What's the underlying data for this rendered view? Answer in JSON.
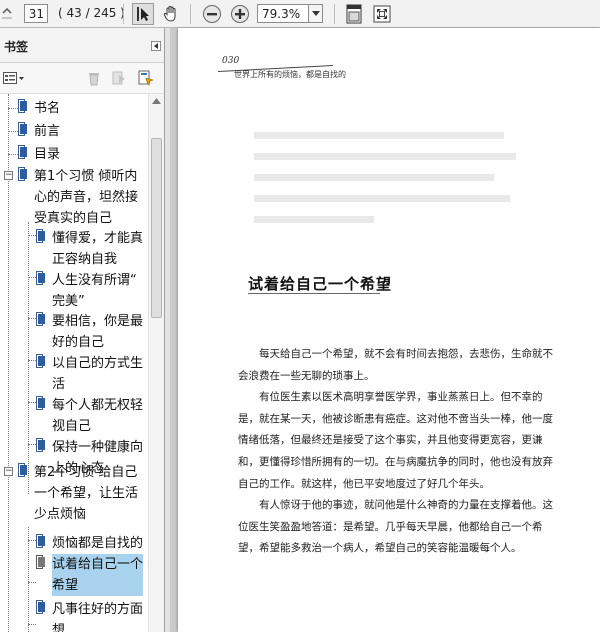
{
  "toolbar": {
    "page_number": "31",
    "page_count": "( 43 / 245 )",
    "zoom": "79.3%"
  },
  "bookmarks_panel": {
    "title": "书签",
    "items": [
      {
        "label": "书名"
      },
      {
        "label": "前言"
      },
      {
        "label": "目录"
      },
      {
        "label_lines": [
          "第1个习惯  倾听内",
          "心的声音，坦然接",
          "受真实的自己"
        ],
        "expander": "−"
      },
      {
        "label_lines": [
          "懂得爱，才能真",
          "正容纳自我"
        ]
      },
      {
        "label_lines": [
          "人生没有所谓“",
          "完美”"
        ]
      },
      {
        "label_lines": [
          "要相信，你是最",
          "好的自己"
        ]
      },
      {
        "label_lines": [
          "以自己的方式生",
          "活"
        ]
      },
      {
        "label_lines": [
          "每个人都无权轻",
          "视自己"
        ]
      },
      {
        "label_lines": [
          "保持一种健康向",
          "上的心态"
        ]
      },
      {
        "label_lines": [
          "第2个习惯  给自己",
          "一个希望，让生活",
          "少点烦恼"
        ],
        "expander": "−"
      },
      {
        "label_lines": [
          "烦恼都是自找的"
        ]
      },
      {
        "label_lines": [
          "试着给自己一个",
          "希望"
        ],
        "selected": true
      },
      {
        "label_lines": [
          "凡事往好的方面",
          "想"
        ]
      }
    ]
  },
  "document": {
    "page_label": "030",
    "running_head": "世界上所有的烦恼，都是自找的",
    "section_title": "试着给自己一个希望",
    "paragraphs": [
      "每天给自己一个希望，就不会有时间去抱怨，去悲伤，生命就不会浪费在一些无聊的琐事上。",
      "有位医生素以医术高明享誉医学界，事业蒸蒸日上。但不幸的是，就在某一天，他被诊断患有癌症。这对他不啻当头一棒，他一度情绪低落，但最终还是接受了这个事实，并且他变得更宽容，更谦和，更懂得珍惜所拥有的一切。在与病魔抗争的同时，他也没有放弃自己的工作。就这样，他已平安地度过了好几个年头。",
      "有人惊讶于他的事迹，就问他是什么神奇的力量在支撑着他。这位医生笑盈盈地答道：是希望。几乎每天早晨，他都给自己一个希望，希望能多救治一个病人，希望自己的笑容能温暖每个人。"
    ]
  },
  "colors": {
    "selection": "#a8d2ee",
    "toolbar_bg": "#f2f2f2",
    "viewer_bg": "#cbcbcb"
  }
}
